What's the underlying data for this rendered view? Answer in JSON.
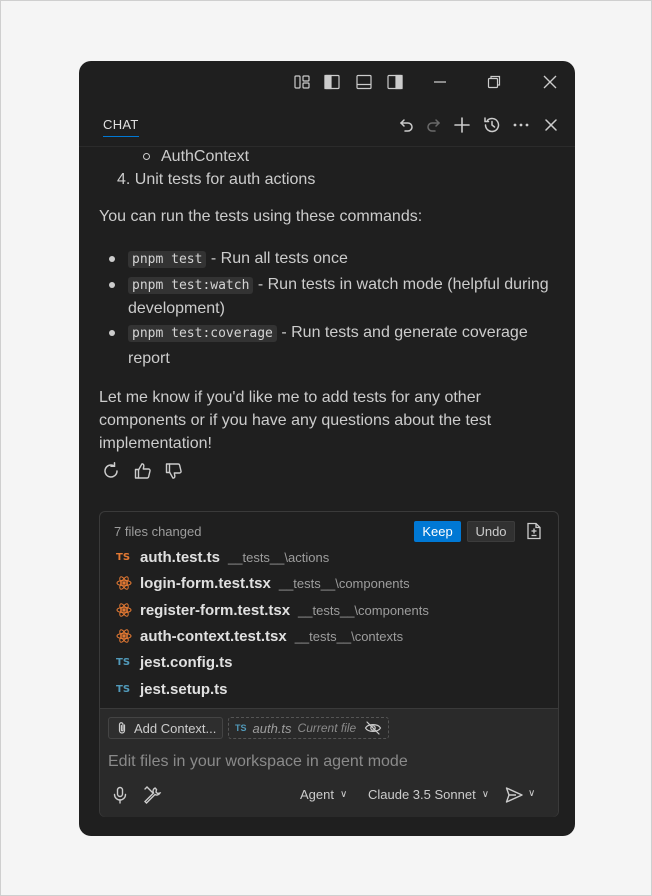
{
  "header": {
    "chat_tab": "CHAT"
  },
  "message": {
    "sub_item": "AuthContext",
    "list_item_4": "4. Unit tests for auth actions",
    "commands_intro": "You can run the tests using these commands:",
    "commands": [
      {
        "code": "pnpm test",
        "text_line1": " - Run all tests once",
        "text_line2": ""
      },
      {
        "code": "pnpm test:watch",
        "text_line1": " - Run tests in watch mode (helpful during",
        "text_line2": "development)"
      },
      {
        "code": "pnpm test:coverage",
        "text_line1": " - Run tests and generate coverage",
        "text_line2": "report"
      }
    ],
    "closing_line1": "Let me know if you'd like me to add tests for any other",
    "closing_line2": "components or if you have any questions about the test",
    "closing_line3": "implementation!"
  },
  "changes": {
    "count_label": "7 files changed",
    "keep_label": "Keep",
    "undo_label": "Undo",
    "files": [
      {
        "badge": "TS",
        "kind": "ts-orange",
        "name": "auth.test.ts",
        "path": "__tests__\\actions"
      },
      {
        "badge": "react",
        "kind": "react",
        "name": "login-form.test.tsx",
        "path": "__tests__\\components"
      },
      {
        "badge": "react",
        "kind": "react",
        "name": "register-form.test.tsx",
        "path": "__tests__\\components"
      },
      {
        "badge": "react",
        "kind": "react",
        "name": "auth-context.test.tsx",
        "path": "__tests__\\contexts"
      },
      {
        "badge": "TS",
        "kind": "ts-blue",
        "name": "jest.config.ts",
        "path": ""
      },
      {
        "badge": "TS",
        "kind": "ts-blue",
        "name": "jest.setup.ts",
        "path": ""
      }
    ]
  },
  "input": {
    "add_context_label": "Add Context...",
    "current_file_badge": "TS",
    "current_file_name": "auth.ts",
    "current_file_tag": "Current file",
    "placeholder": "Edit files in your workspace in agent mode",
    "mode_label": "Agent",
    "model_label": "Claude 3.5 Sonnet"
  },
  "colors": {
    "accent": "#0078d4",
    "ts_orange": "#e37933",
    "ts_blue": "#519aba",
    "react": "#e37933"
  }
}
